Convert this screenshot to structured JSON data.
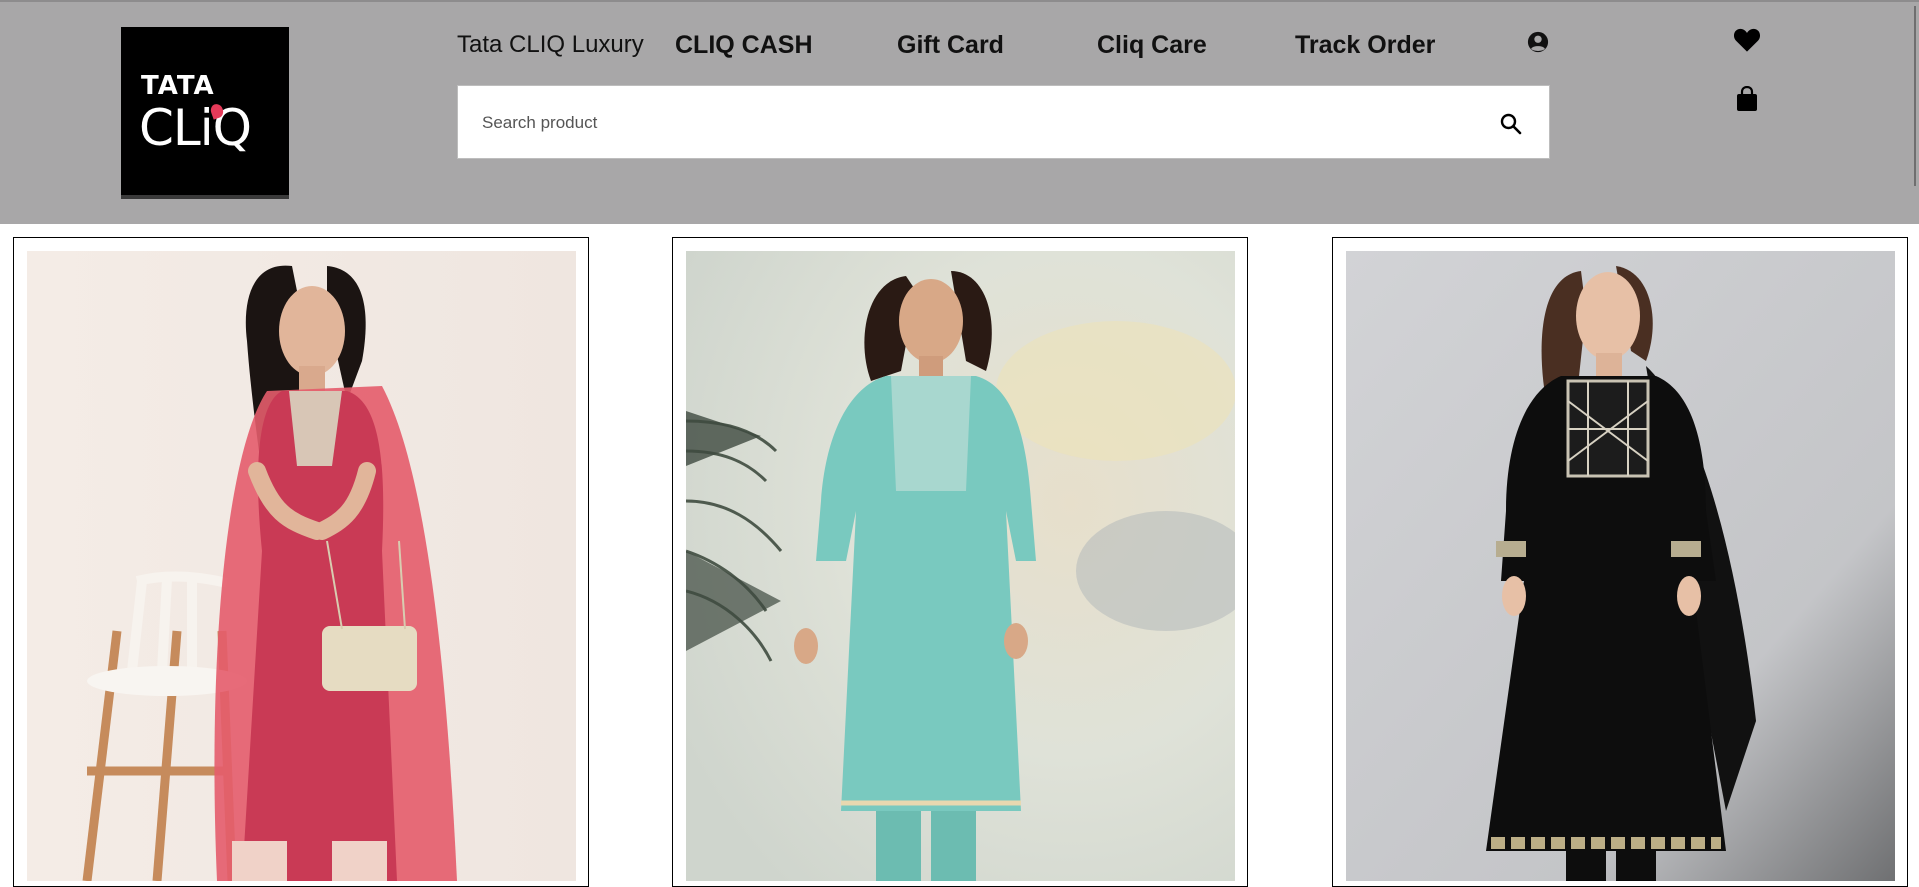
{
  "header": {
    "logo_line1": "TATA",
    "logo_line2": "CLiQ",
    "nav": {
      "luxury": "Tata CLIQ Luxury",
      "cash": "CLIQ CASH",
      "gift": "Gift Card",
      "care": "Cliq Care",
      "track": "Track Order"
    },
    "icons": [
      "user-icon",
      "heart-icon",
      "bag-icon",
      "search-icon"
    ]
  },
  "search": {
    "placeholder": "Search product",
    "value": ""
  },
  "products": [
    {
      "name": "product-card-pink-kurta"
    },
    {
      "name": "product-card-teal-kurta"
    },
    {
      "name": "product-card-black-kurta"
    }
  ],
  "colors": {
    "header_bg": "#a8a7a8",
    "logo_bg": "#000000",
    "logo_accent": "#e53a59"
  }
}
